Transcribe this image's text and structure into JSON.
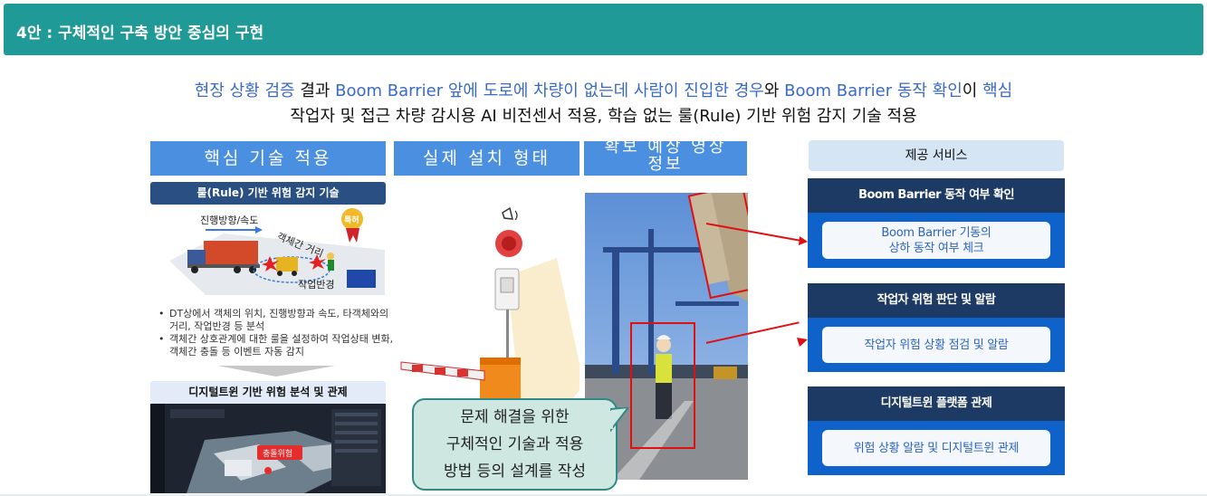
{
  "header": {
    "title": "4안 : 구체적인 구축 방안 중심의 구현"
  },
  "intro": {
    "l1_a": "현장 상황 검증",
    "l1_b": " 결과 ",
    "l1_c": "Boom Barrier 앞에 도로에 차량이 없는데 사람이 진입한 경우",
    "l1_d": "와 ",
    "l1_e": "Boom Barrier 동작 확인",
    "l1_f": "이 ",
    "l1_g": "핵심",
    "line2": "작업자 및 접근 차량 감시용 AI 비전센서 적용, 학습 없는 룰(Rule) 기반 위험 감지 기술 적용"
  },
  "columns": {
    "core": "핵심 기술 적용",
    "install": "실제 설치 형태",
    "video_line1": "확보 예상 영상",
    "video_line2": "정보",
    "service": "제공 서비스"
  },
  "rule": {
    "bar": "룰(Rule) 기반 위험 감지 기술",
    "label_direction": "진행방향/속도",
    "label_distance": "객체간 거리",
    "label_radius": "작업반경",
    "badge": "특허",
    "bullets": [
      "DT상에서 객체의 위치, 진행방향과 속도, 타객체와의 거리, 작업반경 등 분석",
      "객체간 상호관계에 대한 룰을 설정하여 작업상태 변화, 객체간 충돌 등 이벤트 자동 감지"
    ]
  },
  "dt": {
    "bar": "디지털트윈 기반 위험 분석 및 관제",
    "collision": "충돌위험"
  },
  "services": [
    {
      "head": "Boom Barrier 동작 여부 확인",
      "body1": "Boom Barrier 기동의",
      "body2": "상하 동작 여부 체크"
    },
    {
      "head": "작업자 위험 판단 및 알람",
      "body1": "작업자 위험 상황 점검 및 알람",
      "body2": ""
    },
    {
      "head": "디지털트윈 플랫폼 관제",
      "body1": "위험 상황 알람 및 디지털트윈 관제",
      "body2": ""
    }
  ],
  "callout": {
    "l1": "문제 해결을 위한",
    "l2": "구체적인 기술과 적용",
    "l3": "방법 등의 설계를 작성"
  },
  "colors": {
    "teal": "#1f9a96",
    "blue": "#4b8fe0",
    "navy": "#1c3a63",
    "accent": "#0e62c9",
    "highlight": "#3a6ac8",
    "red": "#e01010"
  }
}
